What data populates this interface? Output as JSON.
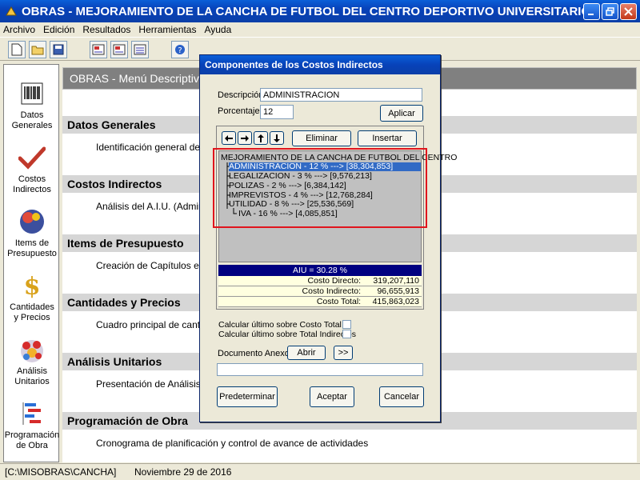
{
  "window": {
    "title": "OBRAS - MEJORAMIENTO DE LA CANCHA DE FUTBOL DEL CENTRO DEPORTIVO UNIVERSITARIO DE LA UNIVERSIDAD ..."
  },
  "menu": [
    "Archivo",
    "Edición",
    "Resultados",
    "Herramientas",
    "Ayuda"
  ],
  "toolbar": {
    "buttons": [
      "new-doc-icon",
      "open-folder-icon",
      "save-disk-icon",
      "report-icon-1",
      "report-icon-2",
      "report-icon-3",
      "help-icon"
    ]
  },
  "sidebar": {
    "items": [
      {
        "label1": "Datos",
        "label2": "Generales",
        "icon": "barcode-icon"
      },
      {
        "label1": "Costos",
        "label2": "Indirectos",
        "icon": "checkmark-icon"
      },
      {
        "label1": "Items de",
        "label2": "Presupuesto",
        "icon": "sphere-icon"
      },
      {
        "label1": "Cantidades",
        "label2": "y Precios",
        "icon": "dollar-icon"
      },
      {
        "label1": "Análisis",
        "label2": "Unitarios",
        "icon": "molecules-icon"
      },
      {
        "label1": "Programación",
        "label2": "de Obra",
        "icon": "gantt-icon"
      }
    ]
  },
  "main": {
    "header": "OBRAS - Menú Descriptivo",
    "sections": [
      {
        "title": "Datos Generales",
        "desc": "Identificación general de la"
      },
      {
        "title": "Costos Indirectos",
        "desc": "Análisis del A.I.U. (Administ"
      },
      {
        "title": "Items de Presupuesto",
        "desc": "Creación de Capítulos e Ite"
      },
      {
        "title": "Cantidades y Precios",
        "desc": "Cuadro principal de cantida"
      },
      {
        "title": "Análisis Unitarios",
        "desc": "Presentación de Análisis Ur"
      },
      {
        "title": "Programación de Obra",
        "desc": "Cronograma de planificación y control de avance de actividades"
      }
    ]
  },
  "statusbar": {
    "path": "[C:\\MISOBRAS\\CANCHA]",
    "date": "Noviembre 29 de 2016"
  },
  "dialog": {
    "title": "Componentes de los Costos Indirectos",
    "descripcion_label": "Descripción",
    "descripcion_value": "ADMINISTRACION",
    "porcentaje_label": "Porcentaje",
    "porcentaje_value": "12",
    "aplicar": "Aplicar",
    "eliminar": "Eliminar",
    "insertar": "Insertar",
    "tree": {
      "root": "MEJORAMIENTO DE LA CANCHA DE FUTBOL DEL CENTRO",
      "items": [
        "ADMINISTRACION - 12 % ---> [38,304,853]",
        "LEGALIZACION - 3 % ---> [9,576,213]",
        "POLIZAS - 2 % ---> [6,384,142]",
        "IMPREVISTOS - 4 % ---> [12,768,284]",
        "UTILIDAD - 8 % ---> [25,536,569]"
      ],
      "subitem": "IVA - 16 % ---> [4,085,851]"
    },
    "aiu": "AIU = 30.28 %",
    "costs": [
      {
        "label": "Costo Directo:",
        "value": "319,207,110"
      },
      {
        "label": "Costo Indirecto:",
        "value": "96,655,913"
      },
      {
        "label": "Costo Total:",
        "value": "415,863,023"
      }
    ],
    "chk1": "Calcular último sobre Costo Total",
    "chk2": "Calcular último sobre Total Indirectos",
    "doc_label": "Documento Anexo",
    "abrir": "Abrir",
    "more": ">>",
    "doc_value": "",
    "predeterminar": "Predeterminar",
    "aceptar": "Aceptar",
    "cancelar": "Cancelar"
  },
  "colors": {
    "titlebar": "#0842b9",
    "selection": "#316ac5",
    "highlight": "#e0151d",
    "aiu_bar": "#000080"
  }
}
